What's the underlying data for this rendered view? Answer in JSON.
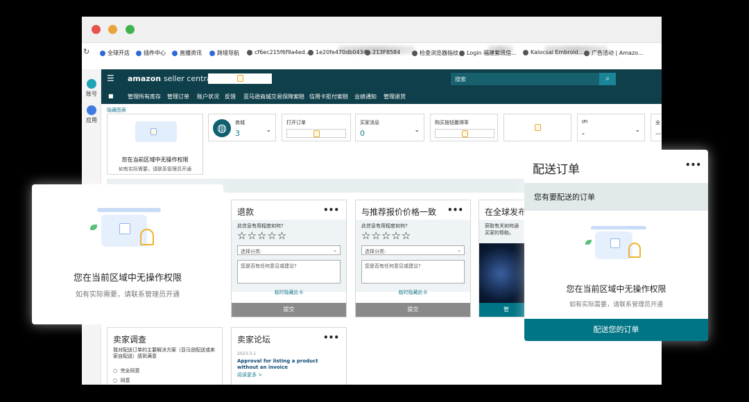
{
  "colors": {
    "teal": "#0f3f4a",
    "accent": "#1b8598",
    "lock": "#e3a72f"
  },
  "bookmarks": [
    {
      "label": "全球开店",
      "icon": "globe-icon"
    },
    {
      "label": "插件中心",
      "icon": "globe-icon"
    },
    {
      "label": "直播资讯",
      "icon": "globe-icon"
    },
    {
      "label": "跨境导航",
      "icon": "globe-icon"
    },
    {
      "label": "cf6ec215f6f9a4ed...",
      "icon": "link-icon"
    },
    {
      "label": "1e20fe470db0434...",
      "icon": "link-icon"
    },
    {
      "label": "213F8584",
      "icon": "link-icon"
    },
    {
      "label": "检查浏览器指纹",
      "icon": "link-icon"
    },
    {
      "label": "Login 福建紫讯信...",
      "icon": "link-icon"
    },
    {
      "label": "Kalocsai Embroid...",
      "icon": "link-icon"
    },
    {
      "label": "广告活动 | Amazo...",
      "icon": "link-icon"
    }
  ],
  "rail": {
    "account": "账号",
    "apps": "应用"
  },
  "header": {
    "brand": "amazon",
    "brand_sub": "seller central",
    "search_placeholder": "搜索"
  },
  "subnav": [
    "管理所有库存",
    "管理订单",
    "账户状况",
    "反馈",
    "亚马逊商城交易保障索赔",
    "信用卡拒付索赔",
    "业绩通知",
    "管理退货"
  ],
  "hide_link": "隐藏图表",
  "perm_card": {
    "title": "您在当前区域中无操作权限",
    "hint": "如有实际需要，请联系管理员开通"
  },
  "metrics": [
    {
      "label": "商城",
      "value": "3"
    },
    {
      "label": "打开订单",
      "value": ""
    },
    {
      "label": "买家消息",
      "value": "0"
    },
    {
      "label": "购买按钮赢得率",
      "value": ""
    },
    {
      "label": "",
      "value": ""
    },
    {
      "label": "IPI",
      "value": "-"
    },
    {
      "label": "全",
      "value": "--"
    }
  ],
  "returns": {
    "title": "退款",
    "question": "此信息有用程度如何?",
    "stars": "☆☆☆☆☆",
    "select": "选择分类:",
    "comment": "您是否有任何意见或建议?",
    "hide": "临时隐藏此卡",
    "submit": "提交"
  },
  "price": {
    "title": "与推荐报价价格一致",
    "question": "此信息有用程度如何?",
    "stars": "☆☆☆☆☆",
    "select": "选择分类:",
    "comment": "您是否有任何意见或建议?",
    "hide": "临时隐藏此卡",
    "submit": "提交"
  },
  "global": {
    "title": "在全球发布",
    "text": "获取有关如何通\n买家的帮助。",
    "button": "管"
  },
  "survey": {
    "title": "卖家调查",
    "question": "我对配送订单的主要解决方案（亚马逊配送或卖家自配送）感到满意",
    "options": [
      "完全同意",
      "同意"
    ]
  },
  "forum": {
    "title": "卖家论坛",
    "date": "2023-3-1",
    "post": "Approval for listing a product without an invoice",
    "more": "阅读更多 >"
  },
  "panel_big": {
    "title": "您在当前区域中无操作权限",
    "hint": "如有实际需要，请联系管理员开通"
  },
  "panel_orders": {
    "title": "配送订单",
    "menu": "•••",
    "subtitle": "您有要配送的订单",
    "perm_title": "您在当前区域中无操作权限",
    "perm_hint": "如有实际需要，请联系管理员开通",
    "button": "配送您的订单"
  },
  "dots": "•••"
}
